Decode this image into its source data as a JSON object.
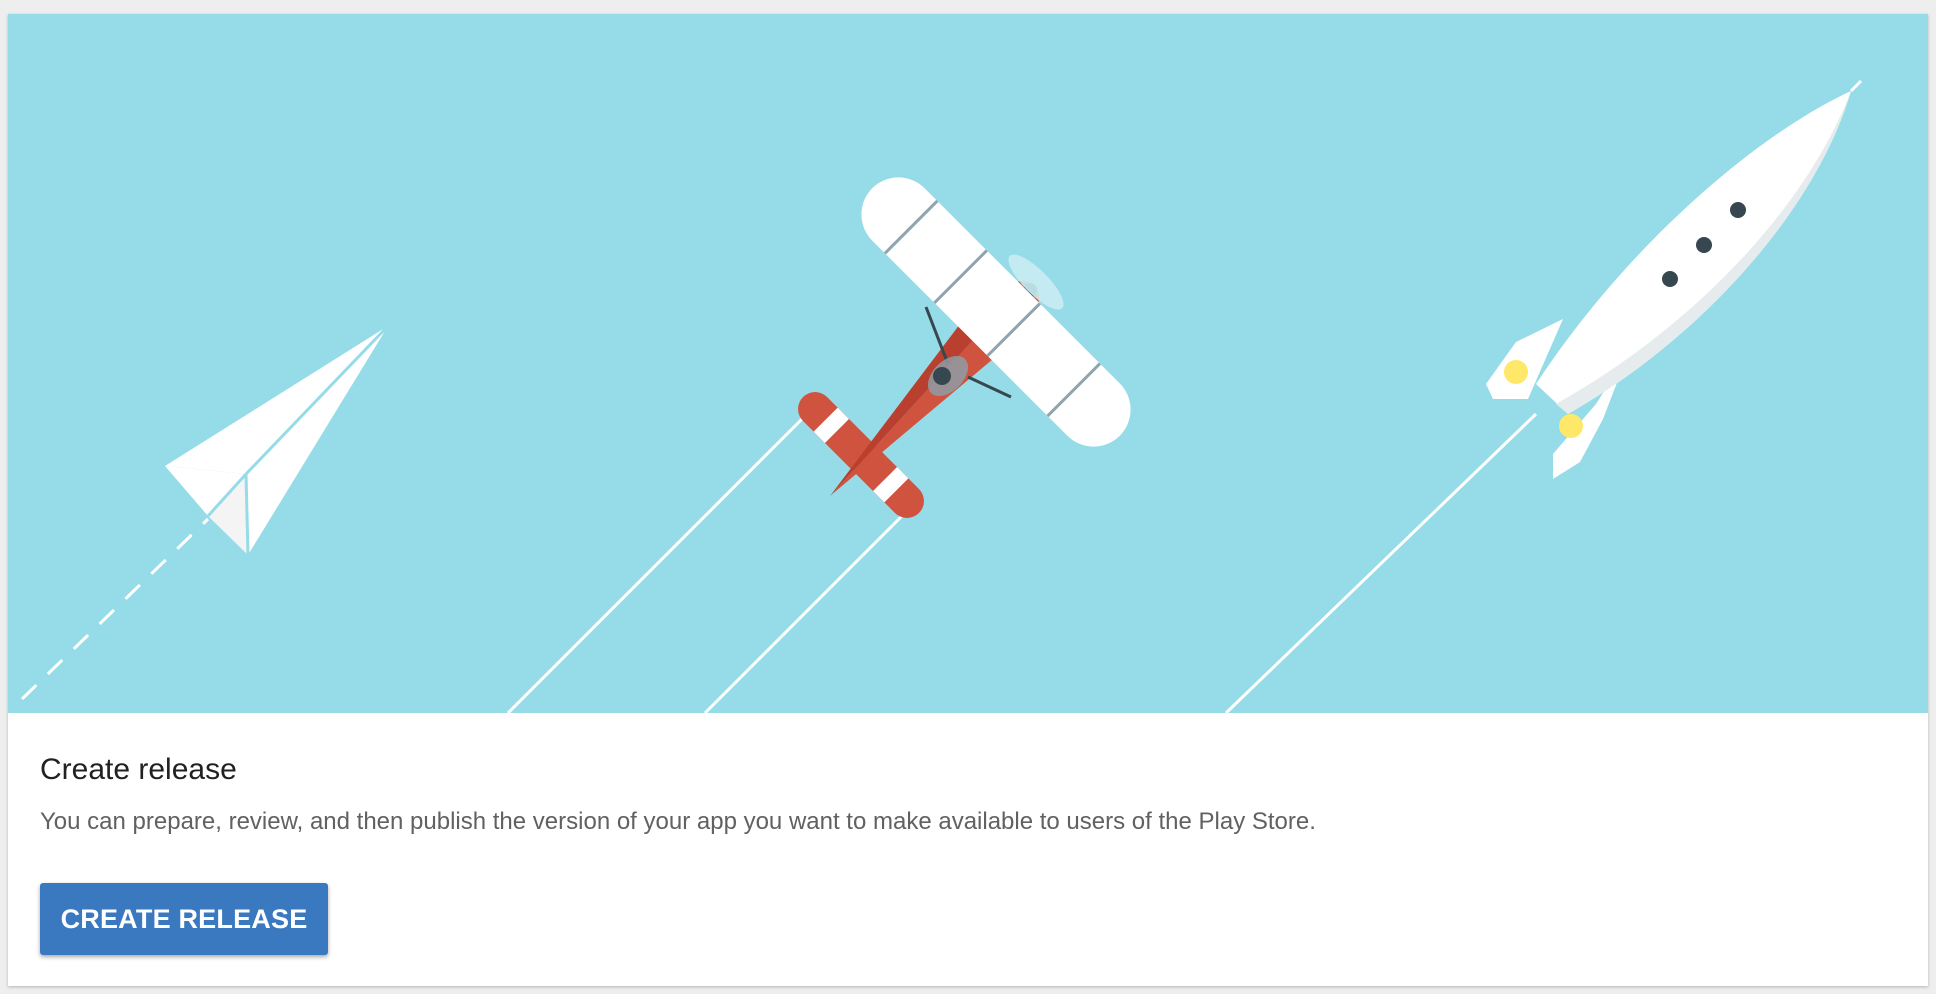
{
  "card": {
    "title": "Create release",
    "description": "You can prepare, review, and then publish the version of your app you want to make available to users of the Play Store.",
    "button_label": "CREATE RELEASE"
  },
  "illustration": {
    "background_color": "#96dce8",
    "items": [
      "paper-plane-icon",
      "biplane-icon",
      "rocket-icon"
    ]
  },
  "colors": {
    "accent": "#3a78bf",
    "plane_red": "#d05340",
    "rocket_window": "#ffe869",
    "dark_detail": "#37474f"
  }
}
